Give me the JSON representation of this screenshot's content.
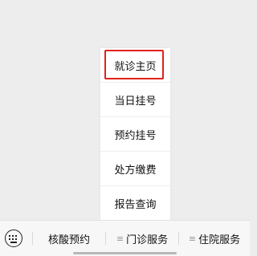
{
  "popup_menu": {
    "items": [
      {
        "label": "就诊主页",
        "selected": true
      },
      {
        "label": "当日挂号"
      },
      {
        "label": "预约挂号"
      },
      {
        "label": "处方缴费"
      },
      {
        "label": "报告查询"
      }
    ]
  },
  "bottom_bar": {
    "keyboard_icon": "keyboard-icon",
    "menu_icon": "list-icon",
    "tabs": [
      {
        "label": "核酸预约"
      },
      {
        "label": "门诊服务"
      },
      {
        "label": "住院服务"
      }
    ],
    "menu_glyph": "≡"
  },
  "colors": {
    "highlight_border": "#e0221b",
    "background": "#ededed"
  }
}
